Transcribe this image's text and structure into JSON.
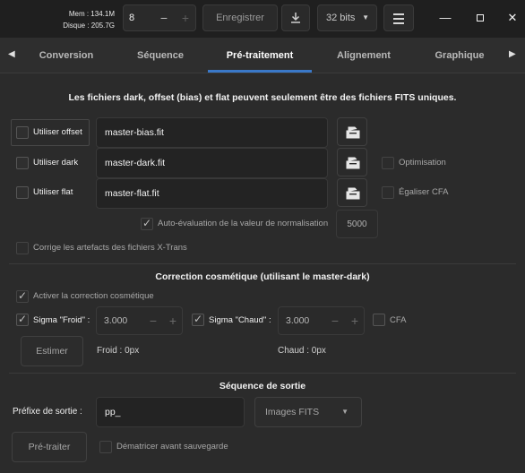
{
  "header": {
    "mem_label": "Mem : 134.1M",
    "disk_label": "Disque : 205.7G",
    "threads_value": "8",
    "save_label": "Enregistrer",
    "bitdepth_label": "32 bits"
  },
  "tabs": [
    {
      "label": "Conversion"
    },
    {
      "label": "Séquence"
    },
    {
      "label": "Pré-traitement"
    },
    {
      "label": "Alignement"
    },
    {
      "label": "Graphique"
    }
  ],
  "masters": {
    "title": "Les fichiers dark, offset (bias) et flat peuvent seulement être des fichiers FITS uniques.",
    "use_offset_label": "Utiliser offset",
    "use_dark_label": "Utiliser dark",
    "use_flat_label": "Utiliser flat",
    "offset_file": "master-bias.fit",
    "dark_file": "master-dark.fit",
    "flat_file": "master-flat.fit",
    "optimisation_label": "Optimisation",
    "equalize_cfa_label": "Égaliser CFA",
    "auto_norm_label": "Auto-évaluation de la valeur de normalisation",
    "norm_value": "5000",
    "xtrans_label": "Corrige les artefacts des fichiers X-Trans"
  },
  "cosmetic": {
    "title": "Correction cosmétique (utilisant le master-dark)",
    "activate_label": "Activer la correction cosmétique",
    "sigma_cold_label": "Sigma \"Froid\" :",
    "sigma_cold_value": "3.000",
    "sigma_hot_label": "Sigma \"Chaud\" :",
    "sigma_hot_value": "3.000",
    "cfa_label": "CFA",
    "estimate_label": "Estimer",
    "cold_result": "Froid : 0px",
    "hot_result": "Chaud : 0px"
  },
  "output": {
    "title": "Séquence de sortie",
    "prefix_label": "Préfixe de sortie :",
    "prefix_value": "pp_",
    "format_value": "Images FITS",
    "preprocess_label": "Pré-traiter",
    "debayer_label": "Dématricer avant sauvegarde"
  }
}
